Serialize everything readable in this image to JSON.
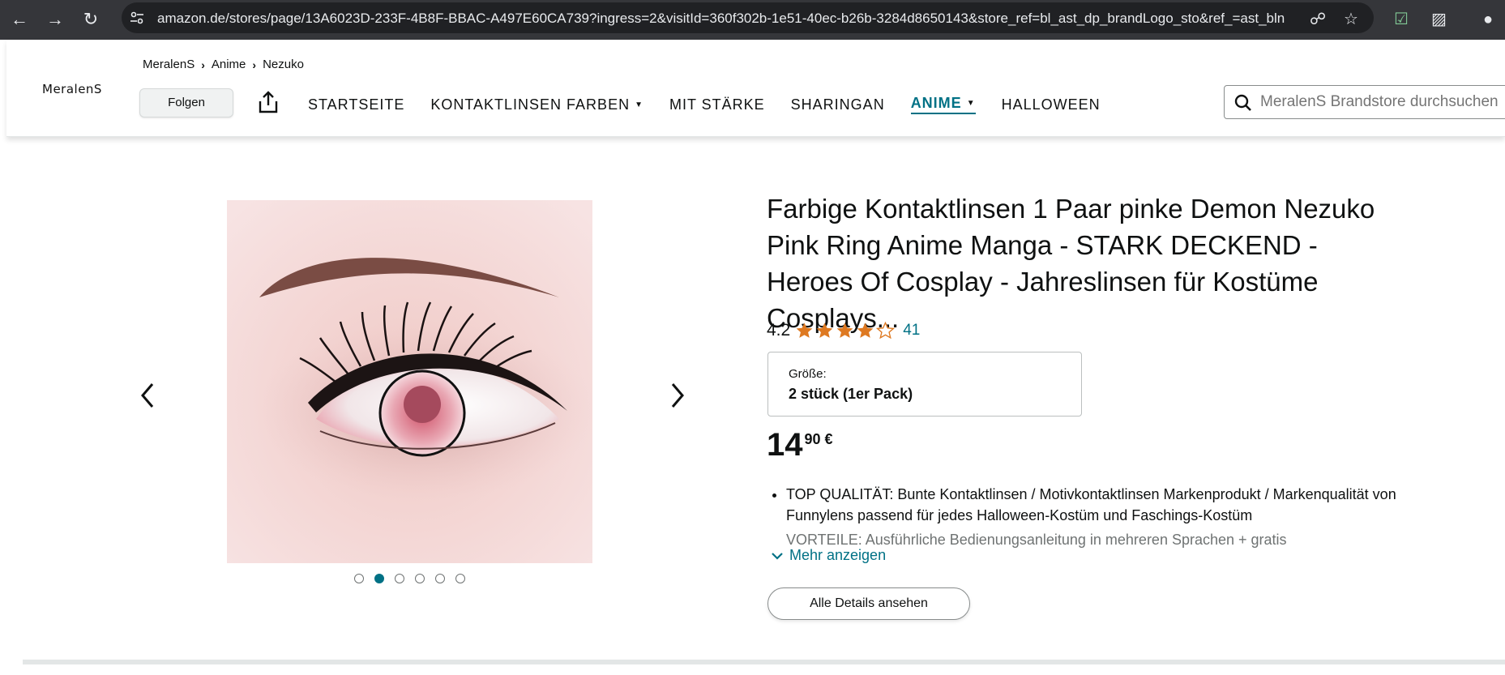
{
  "browser": {
    "url_host": "amazon.de",
    "url_path": "/stores/page/13A6023D-233F-4B8F-BBAC-A497E60CA739?ingress=2&visitId=360f302b-1e51-40ec-b26b-3284d8650143&store_ref=bl_ast_dp_brandLogo_sto&ref_=ast_bln"
  },
  "store": {
    "logo_text": "MeralenS",
    "breadcrumbs": [
      "MeralenS",
      "Anime",
      "Nezuko"
    ],
    "follow_label": "Folgen",
    "nav": [
      {
        "label": "STARTSEITE",
        "dropdown": false,
        "active": false
      },
      {
        "label": "KONTAKTLINSEN FARBEN",
        "dropdown": true,
        "active": false
      },
      {
        "label": "MIT STÄRKE",
        "dropdown": false,
        "active": false
      },
      {
        "label": "SHARINGAN",
        "dropdown": false,
        "active": false
      },
      {
        "label": "ANIME",
        "dropdown": true,
        "active": true
      },
      {
        "label": "HALLOWEEN",
        "dropdown": false,
        "active": false
      }
    ],
    "search_placeholder": "MeralenS Brandstore durchsuchen"
  },
  "product": {
    "title": "Farbige Kontaktlinsen 1 Paar pinke Demon Nezuko Pink Ring Anime Manga - STARK DECKEND - Heroes Of Cosplay - Jahreslinsen für Kostüme Cosplays...",
    "rating": "4.2",
    "rating_value": 4.2,
    "review_count": "41",
    "size_label": "Größe:",
    "size_value": "2 stück (1er Pack)",
    "price_whole": "14",
    "price_fraction": "90 €",
    "bullets": [
      "TOP QUALITÄT: Bunte Kontaktlinsen / Motivkontaktlinsen Markenprodukt / Markenqualität von Funnylens passend für jedes Halloween-Kostüm und Faschings-Kostüm",
      "VORTEILE: Ausführliche Bedienungsanleitung in mehreren Sprachen + gratis"
    ],
    "show_more_label": "Mehr anzeigen",
    "details_button": "Alle Details ansehen",
    "carousel_dots": 6,
    "carousel_active": 2
  },
  "colors": {
    "accent": "#007185",
    "star": "#de7921"
  }
}
